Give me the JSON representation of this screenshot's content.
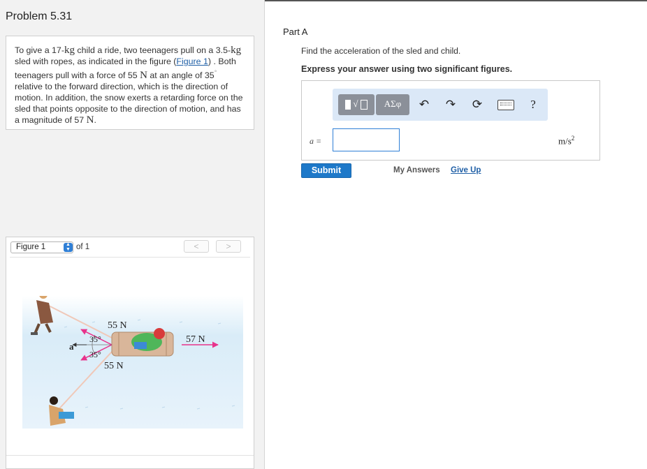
{
  "problem": {
    "title": "Problem 5.31",
    "text_1": "To give a 17-",
    "unit_kg_1": "kg",
    "text_2": " child a ride, two teenagers pull on a 3.5-",
    "unit_kg_2": "kg",
    "text_3": " sled with ropes, as indicated in the figure (",
    "figure_link": "Figure 1",
    "text_4": ") . Both teenagers pull with a force of 55 ",
    "unit_N_1": "N",
    "text_5": " at an angle of 35",
    "degree": "°",
    "text_6": " relative to the forward direction, which is the direction of motion. In addition, the snow exerts a retarding force on the sled that points opposite to the direction of motion, and has a magnitude of 57 ",
    "unit_N_2": "N",
    "text_7": "."
  },
  "figure": {
    "selector_value": "Figure 1",
    "of_label": "of 1",
    "prev_label": "<",
    "next_label": ">",
    "force_top": "55 N",
    "force_bottom": "55 N",
    "angle_top": "35°",
    "angle_bottom": "35°",
    "retard_force": "57 N",
    "accel_symbol": "a"
  },
  "part": {
    "title": "Part A",
    "question": "Find the acceleration of the sled and child.",
    "instruction": "Express your answer using two significant figures."
  },
  "toolbar": {
    "template_label": "√",
    "greek_label": "ΑΣφ",
    "help_label": "?",
    "icons": [
      "templates-icon",
      "greek-symbols-icon",
      "undo-icon",
      "redo-icon",
      "reset-icon",
      "keyboard-icon",
      "help-icon"
    ]
  },
  "answer": {
    "variable": "a =",
    "value": "",
    "units": "m/s",
    "units_exp": "2"
  },
  "actions": {
    "submit": "Submit",
    "my_answers": "My Answers",
    "give_up": "Give Up"
  },
  "colors": {
    "accent": "#1e79c9",
    "link": "#1f5fa6",
    "toolbar_bg": "#dbe8f7",
    "force_arrow": "#e8338b"
  }
}
